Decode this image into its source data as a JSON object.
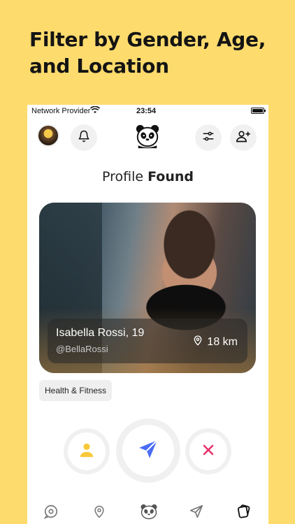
{
  "headline": {
    "line1": "Filter by Gender, Age,",
    "line2": "and Location"
  },
  "status_bar": {
    "carrier": "Network Provider",
    "time": "23:54"
  },
  "header": {
    "avatar_icon": "user-avatar",
    "notification_icon": "bell-icon",
    "logo_icon": "panda-logo",
    "filter_icon": "sliders-icon",
    "add_friend_icon": "add-user-icon"
  },
  "title": {
    "light": "Profile",
    "bold": "Found"
  },
  "profile": {
    "name": "Isabella Rossi, 19",
    "handle": "@BellaRossi",
    "distance": "18 km",
    "interest_tag": "Health & Fitness"
  },
  "actions": {
    "profile_icon": "user-icon",
    "send_icon": "send-icon",
    "dismiss_icon": "close-icon"
  },
  "tabbar": {
    "items": [
      "chat-icon",
      "location-pin-icon",
      "panda-logo",
      "send-icon",
      "cards-icon"
    ]
  },
  "colors": {
    "background": "#fddb6d",
    "accent_blue": "#4a6cf7",
    "accent_pink": "#e6336b",
    "accent_yellow": "#f7c93a"
  }
}
